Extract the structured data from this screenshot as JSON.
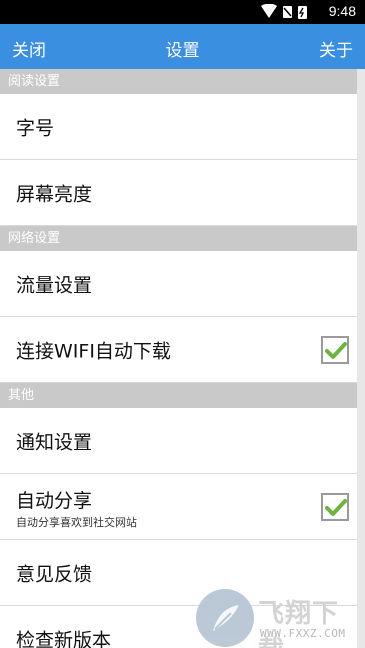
{
  "status_bar": {
    "time": "9:48",
    "icons": [
      "wifi-icon",
      "no-sim-icon",
      "battery-charging-icon"
    ]
  },
  "app_bar": {
    "left": "关闭",
    "title": "设置",
    "right": "关于",
    "color": "#3a8fe0"
  },
  "sections": [
    {
      "header": "阅读设置",
      "items": [
        {
          "label": "字号"
        },
        {
          "label": "屏幕亮度"
        }
      ]
    },
    {
      "header": "网络设置",
      "items": [
        {
          "label": "流量设置"
        },
        {
          "label": "连接WIFI自动下载",
          "checked": true
        }
      ]
    },
    {
      "header": "其他",
      "items": [
        {
          "label": "通知设置"
        },
        {
          "label": "自动分享",
          "sub": "自动分享喜欢到社交网站",
          "checked": true
        },
        {
          "label": "意见反馈"
        },
        {
          "label": "检查新版本"
        }
      ]
    }
  ],
  "watermark": {
    "text": "飞翔下载",
    "url": "WWW.FXXZ.COM"
  },
  "colors": {
    "header_bg": "#c9c9c9",
    "check_green": "#6bb43f"
  }
}
